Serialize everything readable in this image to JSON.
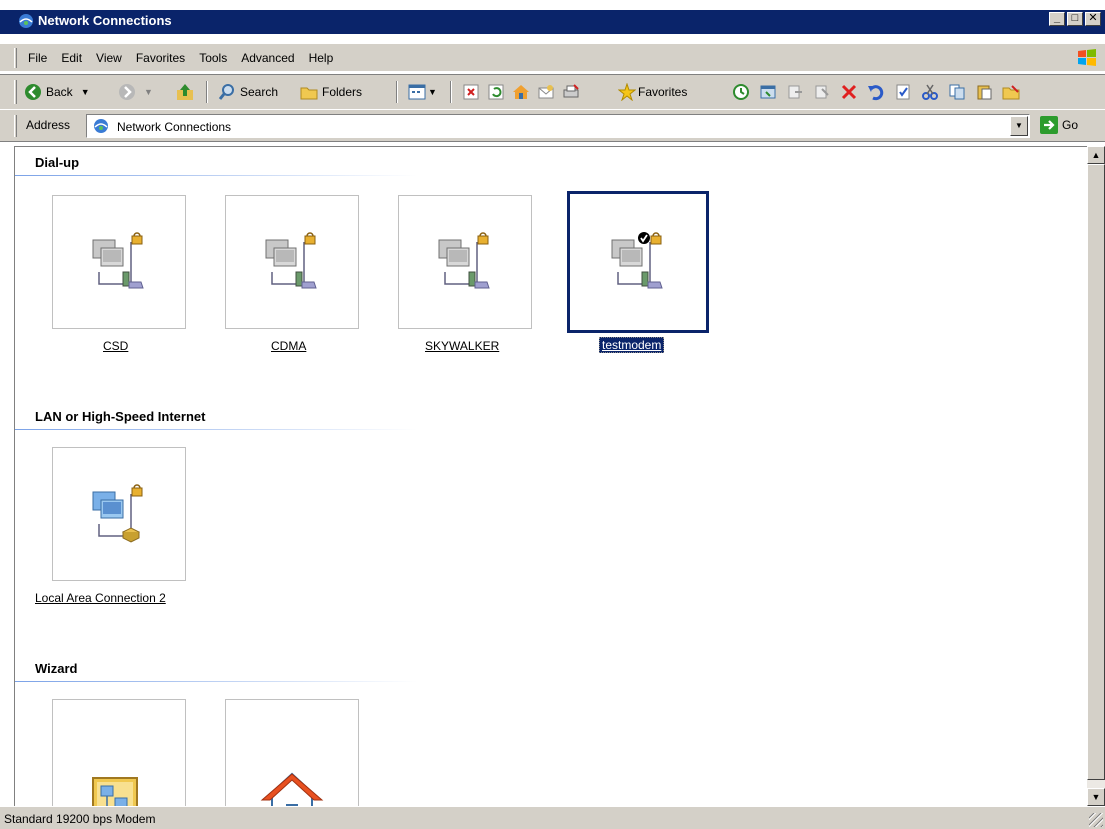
{
  "window": {
    "title": "Network Connections",
    "min_glyph": "_",
    "max_glyph": "□",
    "close_glyph": "✕"
  },
  "menu": [
    "File",
    "Edit",
    "View",
    "Favorites",
    "Tools",
    "Advanced",
    "Help"
  ],
  "toolbar": {
    "back_label": "Back",
    "search_label": "Search",
    "folders_label": "Folders",
    "favorites_label": "Favorites"
  },
  "address": {
    "label": "Address",
    "value": "Network Connections",
    "go_label": "Go"
  },
  "groups": [
    {
      "title": "Dial-up",
      "items": [
        {
          "label": "CSD",
          "icon": "dialup-connection-icon"
        },
        {
          "label": "CDMA",
          "icon": "dialup-connection-icon"
        },
        {
          "label": "SKYWALKER",
          "icon": "dialup-connection-icon"
        },
        {
          "label": "testmodem",
          "icon": "dialup-connection-default-icon",
          "selected": true
        }
      ]
    },
    {
      "title": "LAN or High-Speed Internet",
      "items": [
        {
          "label": "Local Area Connection 2",
          "icon": "lan-connection-icon"
        }
      ]
    },
    {
      "title": "Wizard",
      "items": [
        {
          "label": "",
          "icon": "new-connection-wizard-icon"
        },
        {
          "label": "",
          "icon": "network-setup-wizard-icon"
        }
      ]
    }
  ],
  "status": {
    "text": "Standard 19200 bps Modem"
  },
  "colors": {
    "titlebar": "#0a246a",
    "chrome": "#d4d0c8",
    "selection": "#0a246a"
  }
}
